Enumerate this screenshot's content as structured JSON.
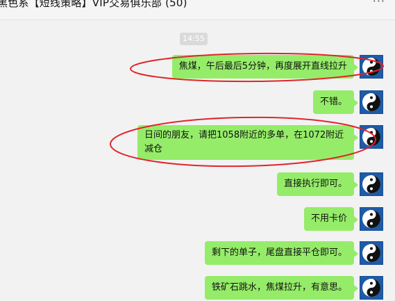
{
  "window": {
    "title": "黑色系【短线策略】VIP交易俱乐部 (50)",
    "more_label": "···"
  },
  "chat": {
    "timestamp": "14:55",
    "messages": [
      {
        "text": "焦煤，午后最后5分钟，再度展开直线拉升"
      },
      {
        "text": "不错。"
      },
      {
        "text": "日间的朋友，请把1058附近的多单，在1072附近减仓"
      },
      {
        "text": "直接执行即可。"
      },
      {
        "text": "不用卡价"
      },
      {
        "text": "剩下的单子，尾盘直接平仓即可。"
      },
      {
        "text": "铁矿石跳水，焦煤拉升，有意思。"
      }
    ],
    "avatar_icon": "yin-yang-icon"
  },
  "colors": {
    "bubble": "#95ec69",
    "avatar_bg": "#1e5ba8",
    "annotation": "#e0242b",
    "background": "#f2f2f2"
  }
}
